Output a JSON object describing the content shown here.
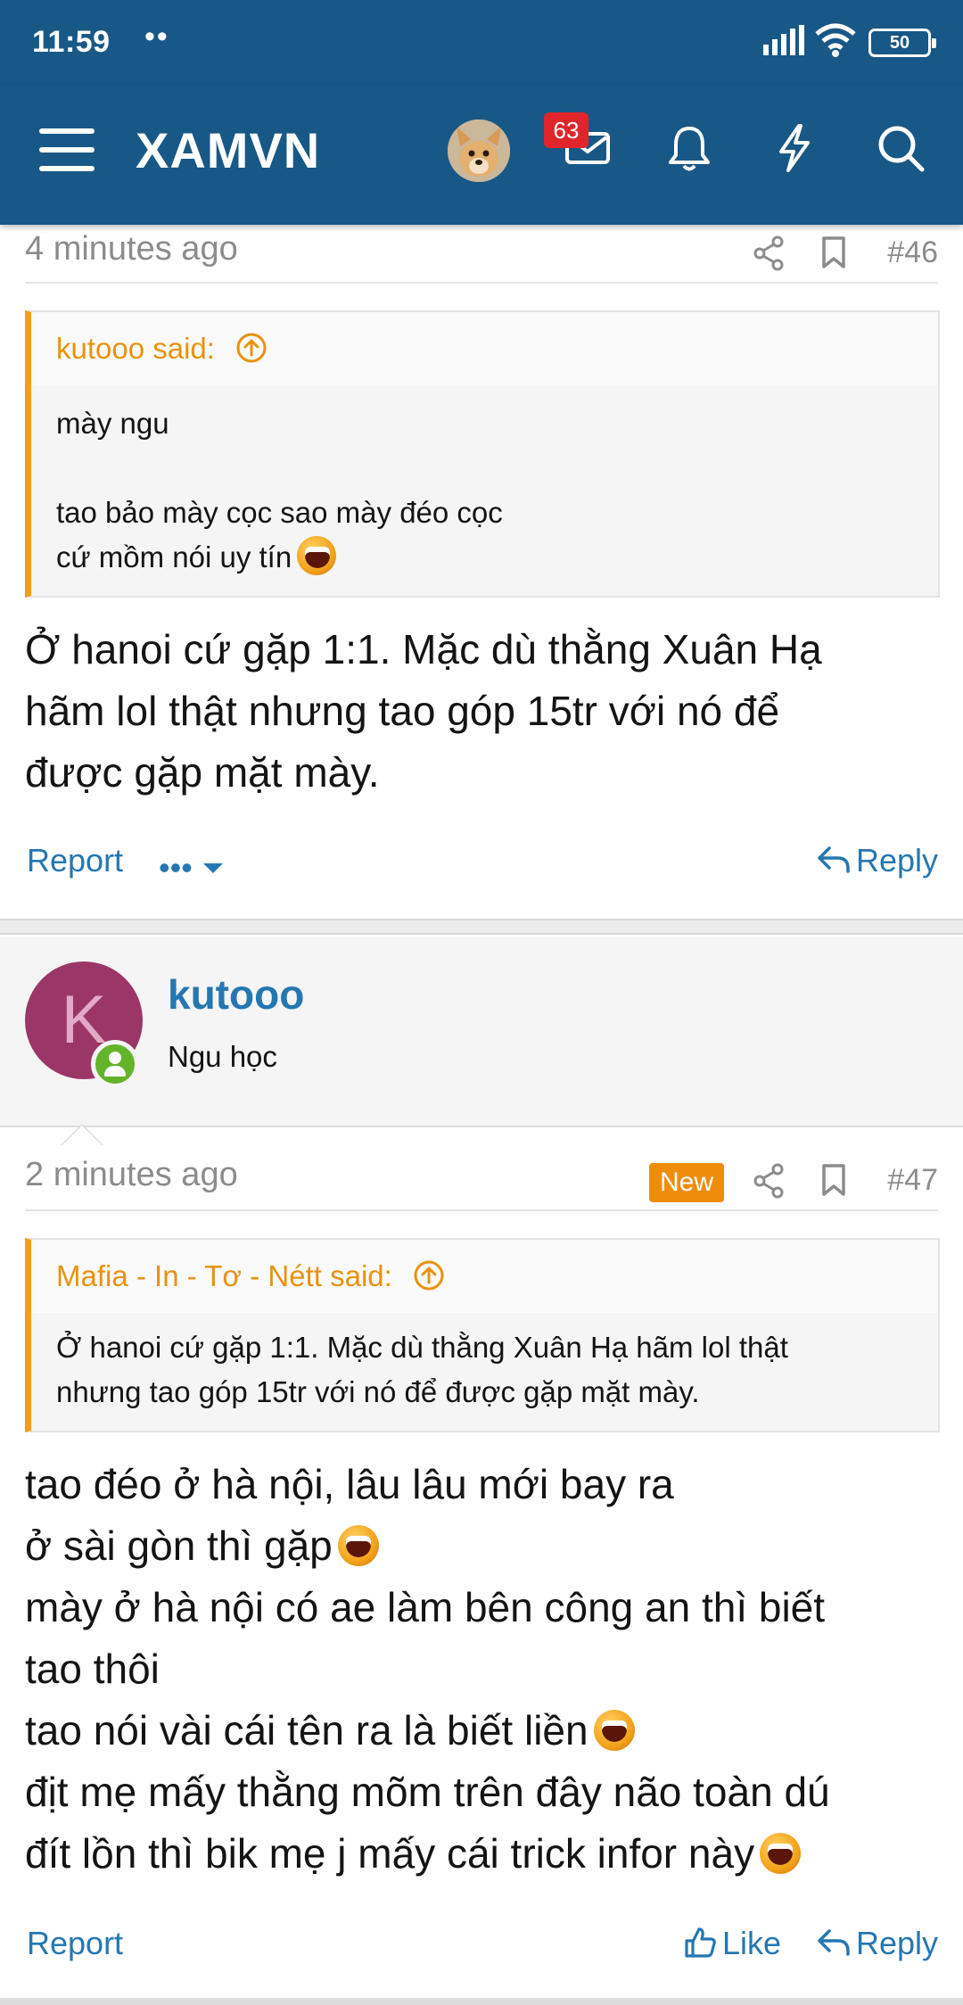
{
  "status_bar": {
    "time": "11:59",
    "dots": "••",
    "battery": "50"
  },
  "header": {
    "site_name": "XAMVN",
    "notification_count": "63"
  },
  "posts": [
    {
      "time_ago": "4 minutes ago",
      "post_number": "#46",
      "quote": {
        "author_line": "kutooo said:",
        "lines": [
          "mày ngu",
          "",
          "tao bảo mày cọc sao mày đéo cọc",
          "cứ mồm nói uy tín"
        ]
      },
      "body_lines": [
        "Ở hanoi cứ gặp 1:1. Mặc dù thằng Xuân Hạ",
        "hãm lol thật nhưng tao góp 15tr với nó để",
        "được gặp mặt mày."
      ],
      "actions": {
        "report": "Report",
        "more": "•••",
        "reply": "Reply"
      }
    },
    {
      "author": {
        "avatar_letter": "K",
        "name": "kutooo",
        "title": "Ngu học"
      },
      "time_ago": "2 minutes ago",
      "new_label": "New",
      "post_number": "#47",
      "quote": {
        "author_line": "Mafia - In - Tơ - Nétt said:",
        "lines": [
          "Ở hanoi cứ gặp 1:1. Mặc dù thằng Xuân Hạ hãm lol thật",
          "nhưng tao góp 15tr với nó để được gặp mặt mày."
        ]
      },
      "body_lines": [
        "tao đéo ở hà nội, lâu lâu mới bay ra",
        "ở sài gòn thì gặp",
        "mày ở hà nội có ae làm bên công an thì biết",
        "tao thôi",
        "tao nói vài cái tên ra là biết liền",
        "địt mẹ mấy thằng mõm trên đây não toàn dú",
        "đít lồn thì bik mẹ j mấy cái trick infor này"
      ],
      "actions": {
        "report": "Report",
        "like": "Like",
        "reply": "Reply"
      }
    }
  ],
  "colors": {
    "header_bg": "#185886",
    "link_blue": "#2577b1",
    "quote_accent": "#f29d1f",
    "new_badge": "#f08c0c",
    "avatar_bg": "#9b3766",
    "online_green": "#63b32b"
  },
  "icons": [
    "menu-icon",
    "user-avatar-icon",
    "inbox-icon",
    "bell-icon",
    "bolt-icon",
    "search-icon",
    "share-icon",
    "bookmark-icon",
    "arrow-up-circle-icon",
    "reply-icon",
    "like-icon",
    "laughing-emoji-icon",
    "online-status-icon"
  ]
}
